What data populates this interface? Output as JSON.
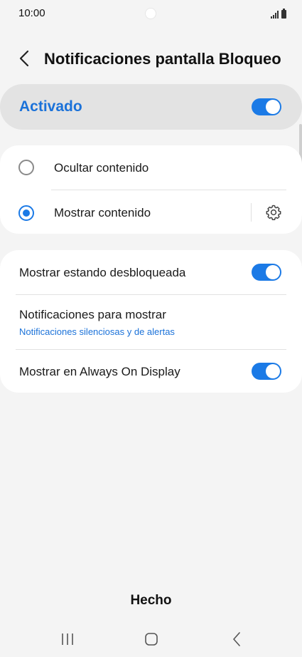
{
  "status_bar": {
    "time": "10:00"
  },
  "header": {
    "title": "Notificaciones pantalla Bloqueo"
  },
  "master_switch": {
    "label": "Activado",
    "on": true
  },
  "content_options": [
    {
      "label": "Ocultar contenido",
      "selected": false
    },
    {
      "label": "Mostrar contenido",
      "selected": true
    }
  ],
  "settings": {
    "show_unlocked": {
      "label": "Mostrar estando desbloqueada",
      "on": true
    },
    "notifications_to_show": {
      "label": "Notificaciones para mostrar",
      "value": "Notificaciones silenciosas y de alertas"
    },
    "always_on_display": {
      "label": "Mostrar en Always On Display",
      "on": true
    }
  },
  "footer": {
    "done_label": "Hecho"
  },
  "colors": {
    "accent": "#1b7ae6",
    "accent_text": "#1b72d9",
    "background": "#f4f4f4",
    "card": "#ffffff",
    "master_bg": "#e3e3e3"
  },
  "icons": [
    "back-arrow-icon",
    "gear-icon",
    "recent-apps-icon",
    "home-icon",
    "nav-back-icon",
    "signal-icon",
    "battery-icon"
  ]
}
